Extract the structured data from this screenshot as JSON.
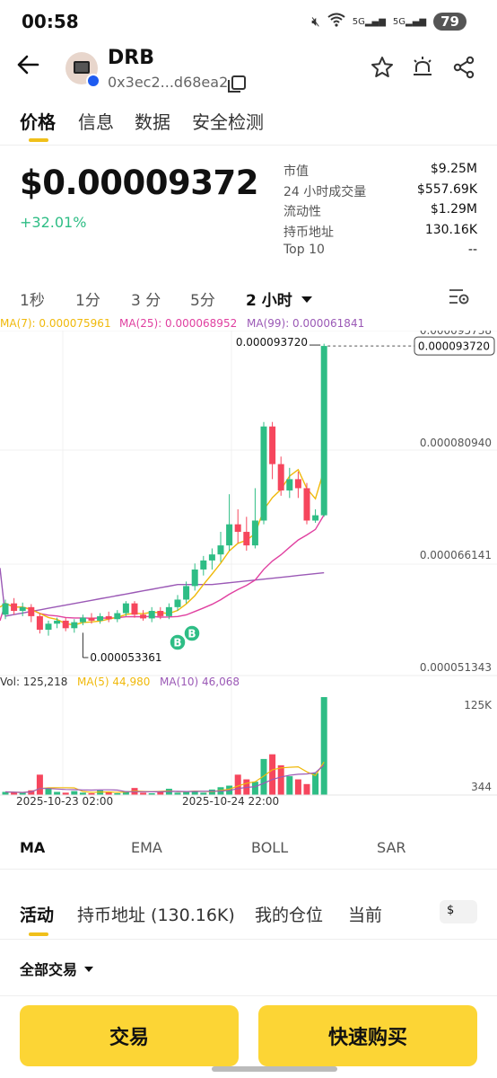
{
  "status_bar": {
    "time": "00:58",
    "net_1": "5G",
    "net_2": "5G",
    "battery": "79"
  },
  "token": {
    "symbol": "DRB",
    "address_short": "0x3ec2...d68ea2"
  },
  "tabs": [
    {
      "label": "价格"
    },
    {
      "label": "信息"
    },
    {
      "label": "数据"
    },
    {
      "label": "安全检测"
    }
  ],
  "price": {
    "value": "$0.00009372",
    "change": "+32.01%"
  },
  "stats": [
    {
      "label": "市值",
      "value": "$9.25M"
    },
    {
      "label": "24 小时成交量",
      "value": "$557.69K"
    },
    {
      "label": "流动性",
      "value": "$1.29M"
    },
    {
      "label": "持币地址",
      "value": "130.16K"
    },
    {
      "label": "Top 10",
      "value": "--"
    }
  ],
  "intervals": [
    "1秒",
    "1分",
    "3 分",
    "5分",
    "2 小时"
  ],
  "ma_legend": {
    "ma7": "MA(7): 0.000075961",
    "ma25": "MA(25): 0.000068952",
    "ma99": "MA(99): 0.000061841"
  },
  "volume_legend": {
    "vol": "Vol: 125,218",
    "ma5": "MA(5) 44,980",
    "ma10": "MA(10) 46,068"
  },
  "colors": {
    "up": "#2ebd85",
    "down": "#f6465d",
    "ma7": "#f0b90b",
    "ma25": "#e040a0",
    "ma99": "#9b59b6",
    "accent": "#fcd535"
  },
  "chart_data": {
    "type": "candlestick",
    "price_axis_labels": [
      "0.000095738",
      "0.000080940",
      "0.000066141",
      "0.000051343"
    ],
    "volume_axis_labels": [
      "125K",
      "344"
    ],
    "ylim": [
      5.1343e-05,
      9.5738e-05
    ],
    "x_labels": [
      "2025-10-23 02:00",
      "2025-10-24 22:00"
    ],
    "last_price_label": "0.000093720",
    "high_label": "0.000093720",
    "low_label": "0.000053361",
    "buy_markers": [
      "B",
      "B"
    ],
    "candles": [
      [
        5.8e-05,
        5.95e-05,
        5.74e-05,
        6e-05
      ],
      [
        5.95e-05,
        5.85e-05,
        5.8e-05,
        6.02e-05
      ],
      [
        5.85e-05,
        5.9e-05,
        5.78e-05,
        5.96e-05
      ],
      [
        5.9e-05,
        5.78e-05,
        5.7e-05,
        5.94e-05
      ],
      [
        5.78e-05,
        5.6e-05,
        5.55e-05,
        5.82e-05
      ],
      [
        5.6e-05,
        5.68e-05,
        5.52e-05,
        5.72e-05
      ],
      [
        5.68e-05,
        5.72e-05,
        5.62e-05,
        5.76e-05
      ],
      [
        5.72e-05,
        5.62e-05,
        5.58e-05,
        5.76e-05
      ],
      [
        5.62e-05,
        5.7e-05,
        5.56e-05,
        5.74e-05
      ],
      [
        5.7e-05,
        5.76e-05,
        5.66e-05,
        5.8e-05
      ],
      [
        5.76e-05,
        5.72e-05,
        5.68e-05,
        5.82e-05
      ],
      [
        5.72e-05,
        5.78e-05,
        5.68e-05,
        5.82e-05
      ],
      [
        5.78e-05,
        5.74e-05,
        5.7e-05,
        5.84e-05
      ],
      [
        5.74e-05,
        5.82e-05,
        5.7e-05,
        5.86e-05
      ],
      [
        5.82e-05,
        5.95e-05,
        5.78e-05,
        5.98e-05
      ],
      [
        5.95e-05,
        5.8e-05,
        5.76e-05,
        5.98e-05
      ],
      [
        5.8e-05,
        5.75e-05,
        5.72e-05,
        5.86e-05
      ],
      [
        5.75e-05,
        5.85e-05,
        5.7e-05,
        5.9e-05
      ],
      [
        5.85e-05,
        5.78e-05,
        5.74e-05,
        5.9e-05
      ],
      [
        5.78e-05,
        5.9e-05,
        5.74e-05,
        5.95e-05
      ],
      [
        5.9e-05,
        6e-05,
        5.85e-05,
        6.06e-05
      ],
      [
        6e-05,
        6.18e-05,
        5.95e-05,
        6.24e-05
      ],
      [
        6.18e-05,
        6.4e-05,
        6.12e-05,
        6.48e-05
      ],
      [
        6.4e-05,
        6.52e-05,
        6.32e-05,
        6.58e-05
      ],
      [
        6.52e-05,
        6.6e-05,
        6.4e-05,
        6.68e-05
      ],
      [
        6.6e-05,
        6.72e-05,
        6.5e-05,
        6.9e-05
      ],
      [
        6.72e-05,
        7e-05,
        6.65e-05,
        7.4e-05
      ],
      [
        7e-05,
        6.9e-05,
        6.75e-05,
        7.2e-05
      ],
      [
        6.9e-05,
        6.72e-05,
        6.65e-05,
        7.1e-05
      ],
      [
        6.72e-05,
        7.05e-05,
        6.68e-05,
        7.48e-05
      ],
      [
        7.05e-05,
        8.3e-05,
        7e-05,
        8.36e-05
      ],
      [
        8.3e-05,
        7.8e-05,
        7.6e-05,
        8.36e-05
      ],
      [
        7.8e-05,
        7.45e-05,
        7.38e-05,
        7.9e-05
      ],
      [
        7.45e-05,
        7.6e-05,
        7.35e-05,
        7.75e-05
      ],
      [
        7.6e-05,
        7.48e-05,
        7.35e-05,
        7.7e-05
      ],
      [
        7.48e-05,
        7.05e-05,
        7e-05,
        7.55e-05
      ],
      [
        7.05e-05,
        7.12e-05,
        7.02e-05,
        7.2e-05
      ],
      [
        7.12e-05,
        9.37e-05,
        7.1e-05,
        9.4e-05
      ]
    ],
    "volumes": [
      4,
      3,
      3,
      6,
      26,
      8,
      4,
      3,
      5,
      3,
      2,
      6,
      4,
      2,
      5,
      9,
      3,
      2,
      5,
      8,
      3,
      4,
      5,
      3,
      7,
      10,
      12,
      26,
      20,
      17,
      46,
      52,
      38,
      24,
      20,
      14,
      28,
      125
    ]
  }
}
